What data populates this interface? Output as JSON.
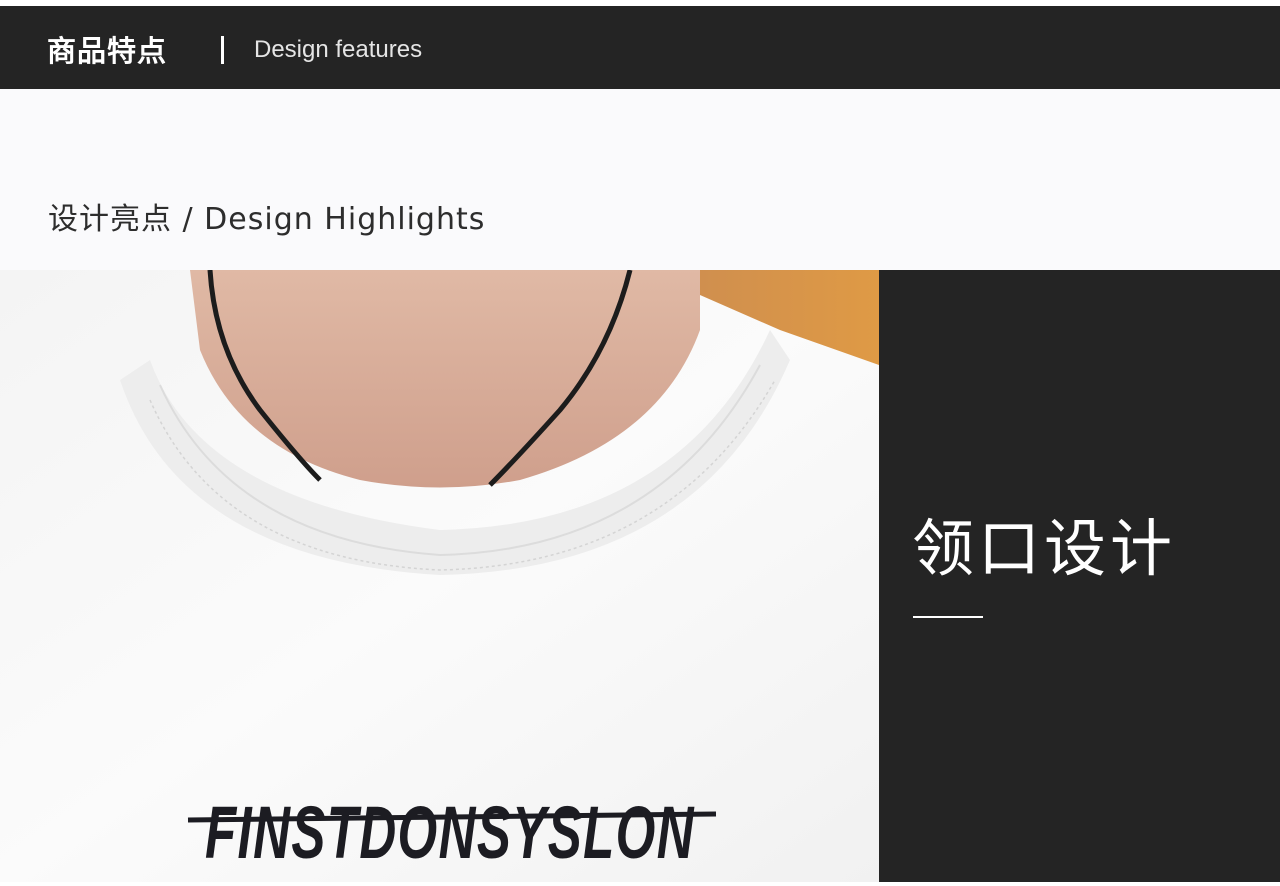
{
  "header": {
    "title_cn": "商品特点",
    "separator": "|",
    "title_en": "Design features"
  },
  "section": {
    "heading": "设计亮点 / Design Highlights"
  },
  "photo": {
    "description_icon": "tshirt-collar-photo",
    "print_text": "FINSTDONSYSLON"
  },
  "panel": {
    "title": "领口设计"
  },
  "colors": {
    "dark": "#242424",
    "light_band": "#fafafc",
    "accent_orange": "#d98a3c"
  }
}
